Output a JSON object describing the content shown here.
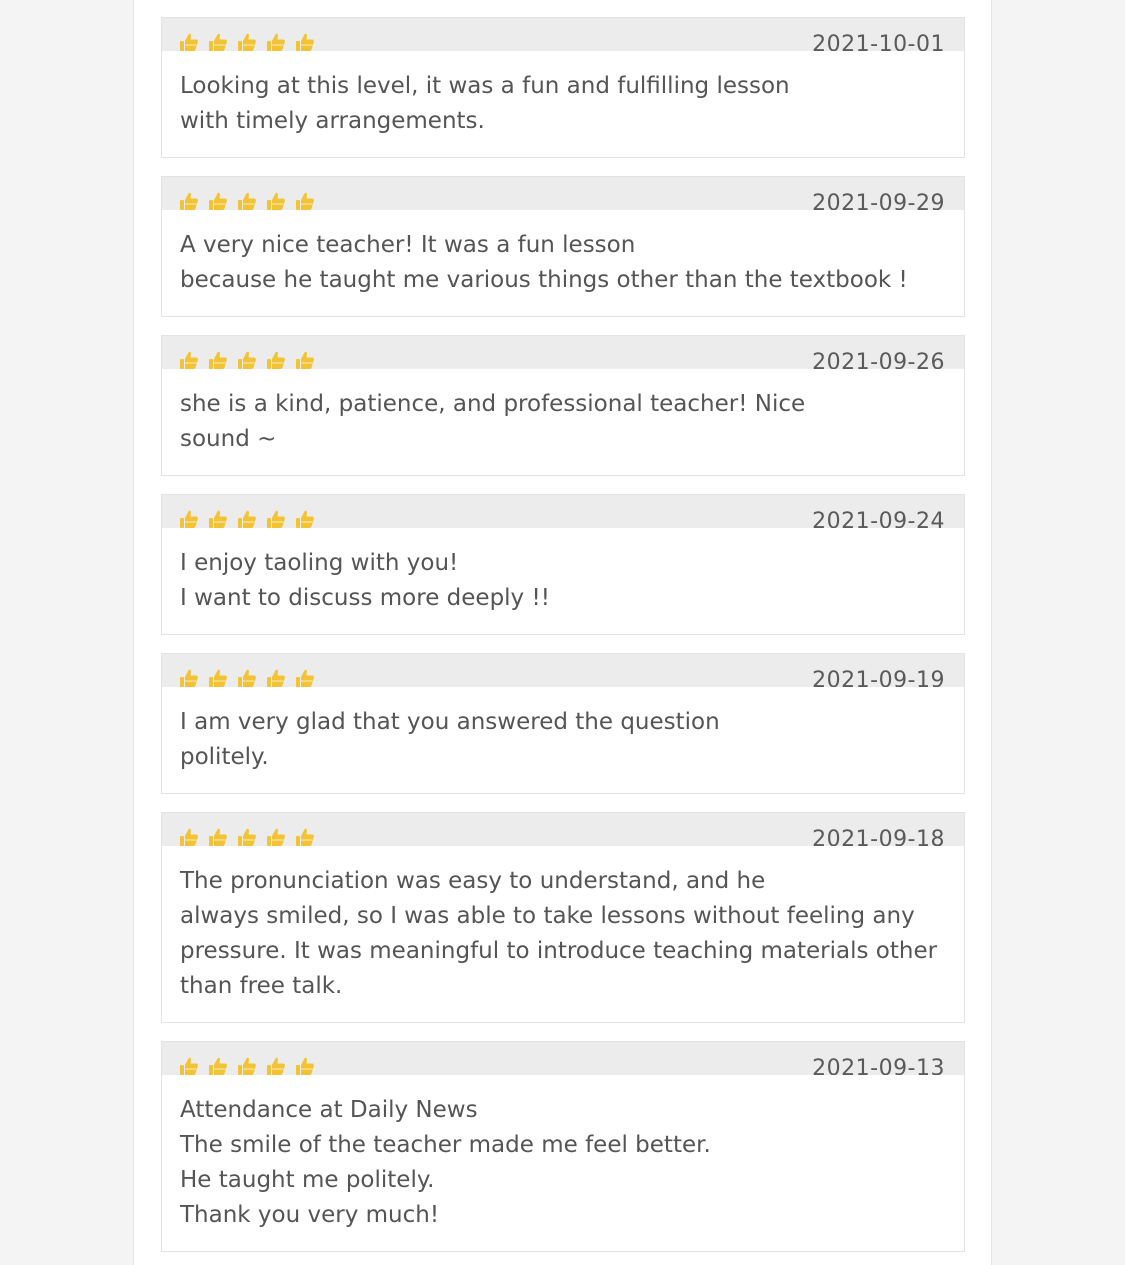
{
  "icons": {
    "rating": "thumbs-up-icon",
    "rating_color": "#f2c335"
  },
  "reviews": [
    {
      "rating": 5,
      "date": "2021-10-01",
      "comment": "Looking at this level, it was a fun and fulfilling lesson\nwith timely arrangements."
    },
    {
      "rating": 5,
      "date": "2021-09-29",
      "comment": "A very nice teacher! It was a fun lesson\nbecause he taught me various things other than the textbook !"
    },
    {
      "rating": 5,
      "date": "2021-09-26",
      "comment": "she is a kind, patience, and professional teacher! Nice\nsound ~"
    },
    {
      "rating": 5,
      "date": "2021-09-24",
      "comment": "I enjoy taoling with you!\nI want to discuss more deeply !!"
    },
    {
      "rating": 5,
      "date": "2021-09-19",
      "comment": "I am very glad that you answered the question\npolitely."
    },
    {
      "rating": 5,
      "date": "2021-09-18",
      "comment": "The pronunciation was easy to understand, and he\nalways smiled, so I was able to take lessons without feeling any\npressure. It was meaningful to introduce teaching materials other\nthan free talk."
    },
    {
      "rating": 5,
      "date": "2021-09-13",
      "comment": "Attendance at Daily News\nThe smile of the teacher made me feel better.\nHe taught me politely.\nThank you very much!"
    }
  ]
}
